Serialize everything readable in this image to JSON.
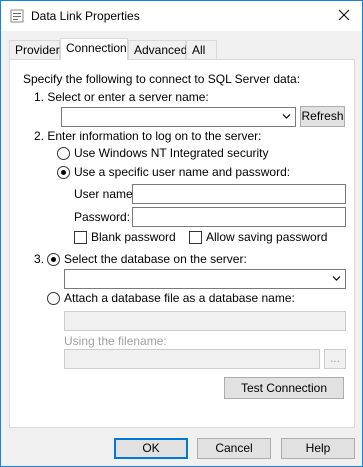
{
  "window": {
    "title": "Data Link Properties"
  },
  "tabs": [
    "Provider",
    "Connection",
    "Advanced",
    "All"
  ],
  "connection": {
    "intro": "Specify the following to connect to SQL Server data:",
    "step1_label": "1. Select or enter a server name:",
    "server_name_value": "",
    "refresh_label": "Refresh",
    "step2_label": "2. Enter information to log on to the server:",
    "radio_windows_nt_label": "Use Windows NT Integrated security",
    "radio_specific_user_label": "Use a specific user name and password:",
    "user_name_label": "User name:",
    "user_name_value": "",
    "password_label": "Password:",
    "password_value": "",
    "blank_password_label": "Blank password",
    "allow_saving_password_label": "Allow saving password",
    "step3_number": "3.",
    "radio_select_database_label": "Select the database on the server:",
    "database_value": "",
    "radio_attach_file_label": "Attach a database file as a database name:",
    "attach_db_name_value": "",
    "using_filename_label": "Using the filename:",
    "filename_value": "",
    "browse_label": "...",
    "test_connection_label": "Test Connection"
  },
  "footer": {
    "ok_label": "OK",
    "cancel_label": "Cancel",
    "help_label": "Help"
  },
  "colors": {
    "window_border": "#1883d7",
    "default_button_border": "#0078d7"
  }
}
